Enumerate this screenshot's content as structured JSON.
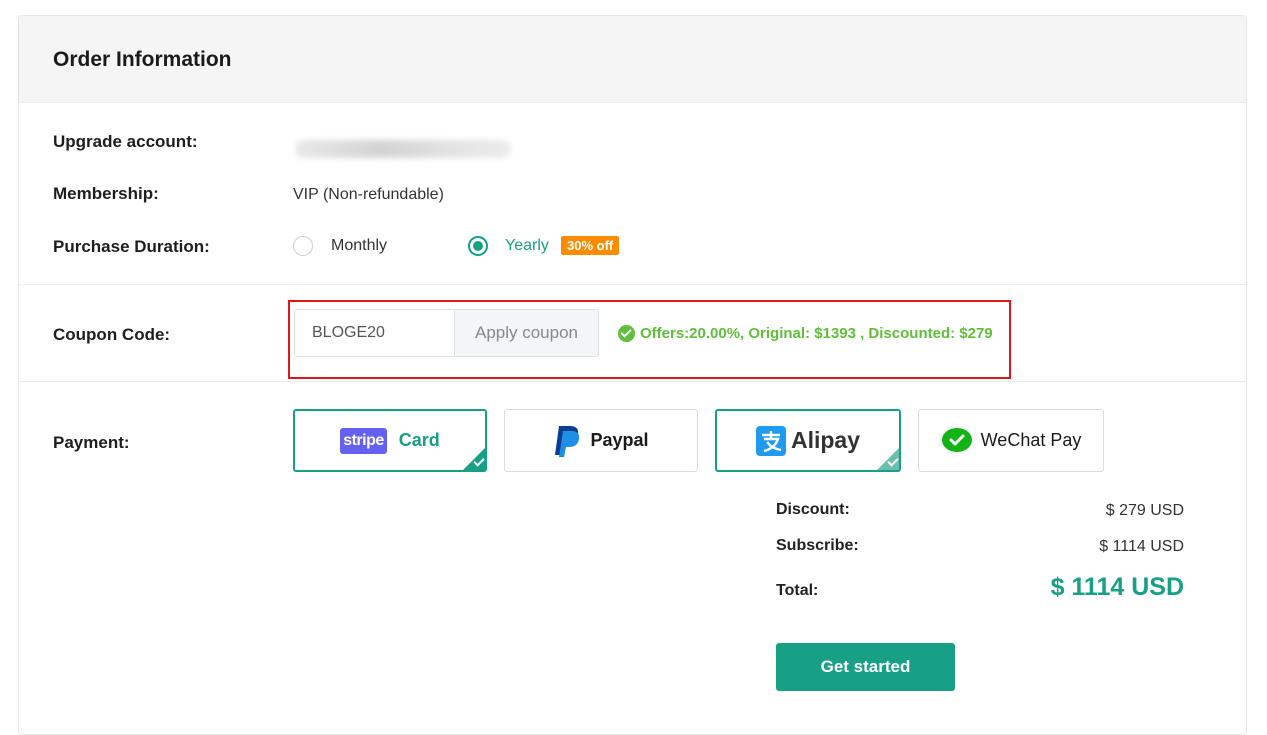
{
  "header": {
    "title": "Order Information"
  },
  "account": {
    "label": "Upgrade account:"
  },
  "membership": {
    "label": "Membership:",
    "value": "VIP (Non-refundable)"
  },
  "duration": {
    "label": "Purchase Duration:",
    "options": [
      {
        "label": "Monthly",
        "selected": false
      },
      {
        "label": "Yearly",
        "selected": true
      }
    ],
    "badge": "30% off"
  },
  "coupon": {
    "label": "Coupon Code:",
    "value": "BLOGE20",
    "button": "Apply coupon",
    "result": "Offers:20.00%, Original: $1393 , Discounted: $279"
  },
  "payment": {
    "label": "Payment:",
    "methods": [
      {
        "label": "Card",
        "logo_text": "stripe",
        "selected": true
      },
      {
        "label": "Paypal",
        "selected": false
      },
      {
        "label": "Alipay",
        "selected": true
      },
      {
        "label": "WeChat Pay",
        "selected": false
      }
    ]
  },
  "summary": {
    "discount_label": "Discount:",
    "discount_value": "$ 279 USD",
    "subscribe_label": "Subscribe:",
    "subscribe_value": "$ 1114 USD",
    "total_label": "Total:",
    "total_value": "$ 1114 USD"
  },
  "cta": {
    "label": "Get started"
  },
  "colors": {
    "accent": "#17a085",
    "badge": "#fb8c00",
    "success": "#5fbf3a",
    "highlight": "#e0161c"
  }
}
